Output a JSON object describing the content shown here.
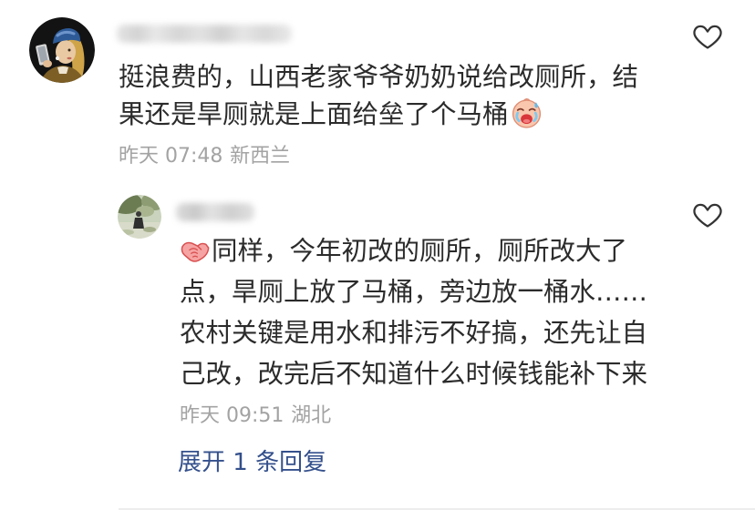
{
  "thread": {
    "comment": {
      "avatar": "girl-with-pearl-earring-avatar",
      "like_icon": "heart-outline-icon",
      "text_lines": [
        "挺浪费的，山西老家爷爷奶奶说给改厕所，结",
        "果还是旱厕就是上面给垒了个马桶"
      ],
      "trailing_emoji": "crying-face-emoji",
      "time": "昨天 07:48",
      "location": "新西兰",
      "reply": {
        "avatar": "outdoor-photo-avatar",
        "like_icon": "heart-outline-icon",
        "leading_emoji": "handshake-emoji",
        "text_lines": [
          "同样，今年初改的厕所，厕所改大了",
          "点，旱厕上放了马桶，旁边放一桶水……",
          "农村关键是用水和排污不好搞，还先让自",
          "己改，改完后不知道什么时候钱能补下来"
        ],
        "time": "昨天 09:51",
        "location": "湖北"
      },
      "expand_replies_label": "展开 1 条回复"
    }
  },
  "colors": {
    "text": "#2b2b2b",
    "meta": "#a3a3a3",
    "link": "#34508c",
    "divider": "#ededed",
    "icon": "#333333"
  }
}
